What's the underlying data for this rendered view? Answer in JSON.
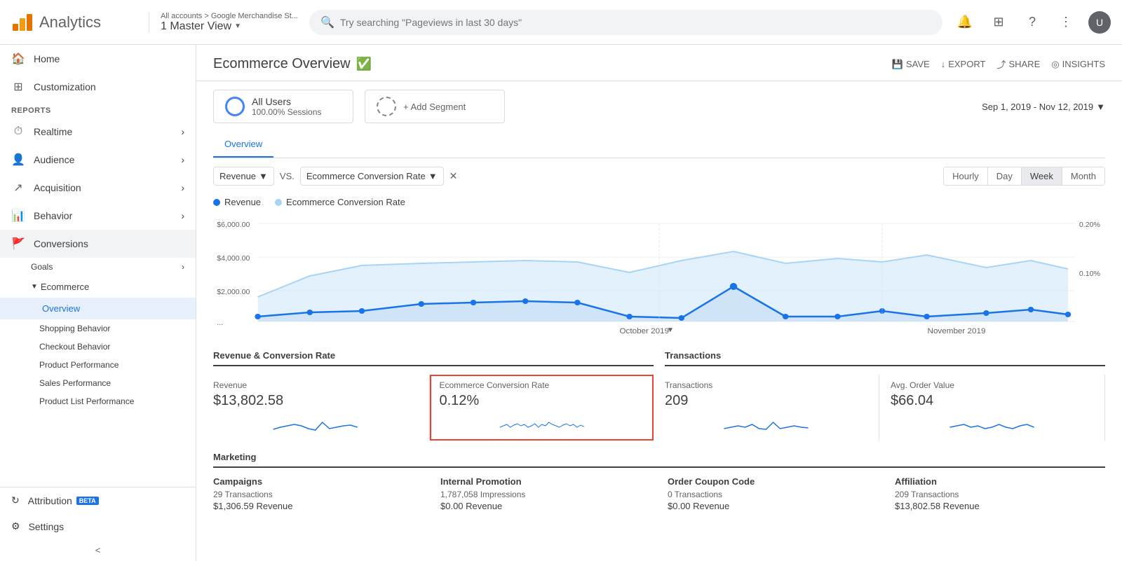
{
  "header": {
    "logo_text": "Analytics",
    "breadcrumb": "All accounts > Google Merchandise St...",
    "account_view": "1 Master View",
    "search_placeholder": "Try searching \"Pageviews in last 30 days\"",
    "save_label": "SAVE",
    "export_label": "EXPORT",
    "share_label": "SHARE",
    "insights_label": "INSIGHTS"
  },
  "sidebar": {
    "home_label": "Home",
    "customization_label": "Customization",
    "reports_label": "REPORTS",
    "realtime_label": "Realtime",
    "audience_label": "Audience",
    "acquisition_label": "Acquisition",
    "behavior_label": "Behavior",
    "conversions_label": "Conversions",
    "goals_label": "Goals",
    "ecommerce_label": "Ecommerce",
    "overview_label": "Overview",
    "shopping_behavior_label": "Shopping Behavior",
    "checkout_behavior_label": "Checkout Behavior",
    "product_performance_label": "Product Performance",
    "sales_performance_label": "Sales Performance",
    "product_list_label": "Product List Performance",
    "attribution_label": "Attribution",
    "beta_label": "BETA",
    "settings_label": "Settings",
    "collapse_label": "<"
  },
  "page": {
    "title": "Ecommerce Overview",
    "verified": "✓"
  },
  "segment": {
    "all_users": "All Users",
    "all_users_detail": "100.00% Sessions",
    "add_segment": "+ Add Segment",
    "date_range": "Sep 1, 2019 - Nov 12, 2019"
  },
  "chart": {
    "tab_overview": "Overview",
    "metric1_label": "Revenue",
    "vs_label": "VS.",
    "metric2_label": "Ecommerce Conversion Rate",
    "time_buttons": [
      "Hourly",
      "Day",
      "Week",
      "Month"
    ],
    "active_time": "Week",
    "legend": [
      {
        "label": "Revenue",
        "color": "#1a73e8"
      },
      {
        "label": "Ecommerce Conversion Rate",
        "color": "#80c8f8"
      }
    ],
    "y_axis_left": [
      "$6,000.00",
      "$4,000.00",
      "$2,000.00",
      "..."
    ],
    "y_axis_right": [
      "0.20%",
      "0.10%"
    ],
    "x_axis": [
      "October 2019",
      "November 2019"
    ]
  },
  "stats": {
    "revenue_group_title": "Revenue & Conversion Rate",
    "transactions_group_title": "Transactions",
    "cards": [
      {
        "label": "Revenue",
        "value": "$13,802.58",
        "highlighted": false
      },
      {
        "label": "Ecommerce Conversion Rate",
        "value": "0.12%",
        "highlighted": true
      },
      {
        "label": "Transactions",
        "value": "209",
        "highlighted": false
      },
      {
        "label": "Avg. Order Value",
        "value": "$66.04",
        "highlighted": false
      }
    ]
  },
  "marketing": {
    "title": "Marketing",
    "columns": [
      {
        "title": "Campaigns",
        "sub": "29 Transactions",
        "value": "$1,306.59 Revenue"
      },
      {
        "title": "Internal Promotion",
        "sub": "1,787,058 Impressions",
        "value": "$0.00 Revenue"
      },
      {
        "title": "Order Coupon Code",
        "sub": "0 Transactions",
        "value": "$0.00 Revenue"
      },
      {
        "title": "Affiliation",
        "sub": "209 Transactions",
        "value": "$13,802.58 Revenue"
      }
    ]
  }
}
